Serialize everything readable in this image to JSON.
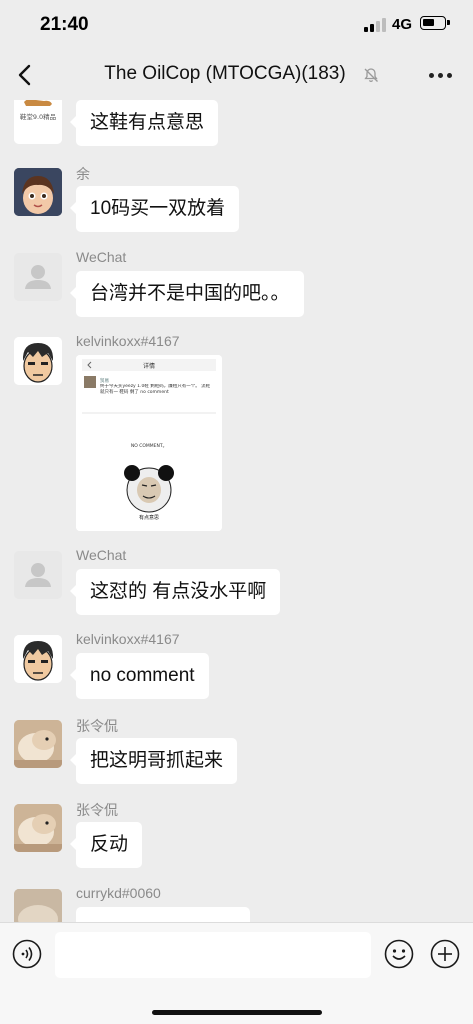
{
  "status_bar": {
    "time": "21:40",
    "network": "4G"
  },
  "nav": {
    "title": "The OilCop (MTOCGA)(183)",
    "back_icon": "chevron-left-icon",
    "mute_icon": "bell-muted-icon",
    "more_icon": "more-dots-icon"
  },
  "messages": [
    {
      "sender": "",
      "text": "这鞋有点意思",
      "avatar_caption": "鞋堂9.0精品"
    },
    {
      "sender": "余",
      "text": "10码买一双放着"
    },
    {
      "sender": "WeChat",
      "text": "台湾并不是中国的吧。。"
    },
    {
      "sender": "kelvinkoxx#4167",
      "type": "image",
      "image": {
        "header_title": "详情",
        "post_name": "贸易",
        "post_text": "终于今天买yeezy 1.0鞋 剩鞋码，廉租只有一个。 流鞋就只有一 鞋码 剩了 no comment",
        "meme_caption_top": "NO COMMENT。",
        "meme_caption_bottom": "有点意思"
      }
    },
    {
      "sender": "WeChat",
      "text": "这怼的 有点没水平啊"
    },
    {
      "sender": "kelvinkoxx#4167",
      "text": "no comment"
    },
    {
      "sender": "张令侃",
      "text": "把这明哥抓起来"
    },
    {
      "sender": "张令侃",
      "text": "反动"
    },
    {
      "sender": "currykd#0060",
      "text": ""
    }
  ],
  "input": {
    "placeholder": "",
    "value": ""
  },
  "icons": {
    "voice": "voice-icon",
    "emoji": "emoji-icon",
    "plus": "plus-icon"
  },
  "colors": {
    "background": "#ededed",
    "bubble": "#ffffff",
    "sender_name": "#8a8a8a"
  }
}
